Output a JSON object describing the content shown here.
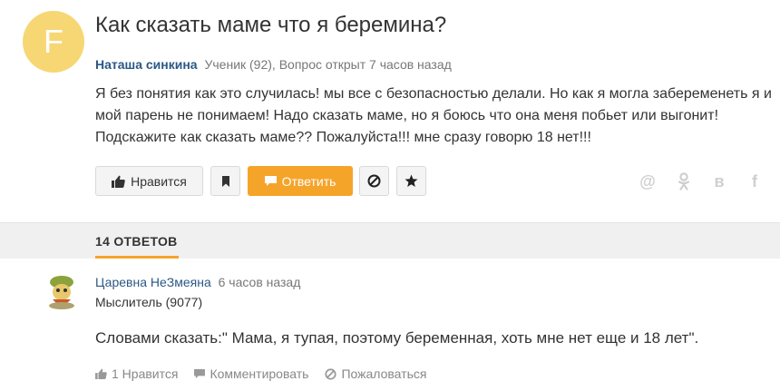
{
  "question": {
    "avatar_letter": "F",
    "title": "Как сказать маме что я беремина?",
    "author": "Наташа синкина",
    "meta": "Ученик (92), Вопрос открыт 7 часов назад",
    "body": "Я без понятия как это случилась! мы все с безопасностью делали. Но как я могла забеременеть я и мой парень не понимаем! Надо сказать маме, но я боюсь что она меня побьет или выгонит! Подскажите как сказать маме?? Пожалуйста!!! мне сразу говорю 18 нет!!!"
  },
  "actions": {
    "like_label": "Нравится",
    "answer_label": "Ответить"
  },
  "share": {
    "at": "@",
    "ok": "ok",
    "vk": "в",
    "fb": "f"
  },
  "answers": {
    "count_label": "14 ОТВЕТОВ",
    "items": [
      {
        "author": "Царевна НеЗмеяна",
        "time": "6 часов назад",
        "rank": "Мыслитель (9077)",
        "body": "Словами сказать:\" Мама, я тупая, поэтому беременная, хоть мне нет еще и 18 лет\".",
        "like_label": "1 Нравится",
        "comment_label": "Комментировать",
        "report_label": "Пожаловаться"
      }
    ]
  },
  "colors": {
    "accent": "#f5a42a",
    "link": "#2a5885",
    "avatar_bg": "#f7d774"
  }
}
